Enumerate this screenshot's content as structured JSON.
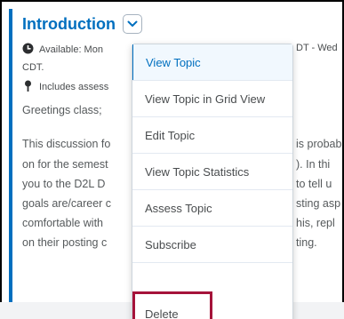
{
  "topic": {
    "title": "Introduction",
    "availability_left": "Available: Mon",
    "availability_right": "DT - Wed",
    "availability_end": "CDT.",
    "includes": "Includes assess"
  },
  "body": {
    "greeting": "Greetings class;",
    "lines": [
      {
        "left": "This discussion fo",
        "right": "is probab"
      },
      {
        "left": "on for the semest",
        "right": "). In thi"
      },
      {
        "left": "you to the D2L D",
        "right": "to tell u"
      },
      {
        "left": "goals are/career c",
        "right": "sting asp"
      },
      {
        "left": "comfortable with",
        "right": "his, repl"
      },
      {
        "left": "on their posting c",
        "right": "ting."
      }
    ]
  },
  "menu": {
    "items": [
      "View Topic",
      "View Topic in Grid View",
      "Edit Topic",
      "View Topic Statistics",
      "Assess Topic",
      "Subscribe",
      "Delete"
    ]
  },
  "colors": {
    "accent": "#006fbf",
    "highlight": "#a5133a"
  },
  "icons": {
    "title_action": "chevron-down-icon",
    "availability": "clock-icon",
    "includes": "pin-icon"
  }
}
